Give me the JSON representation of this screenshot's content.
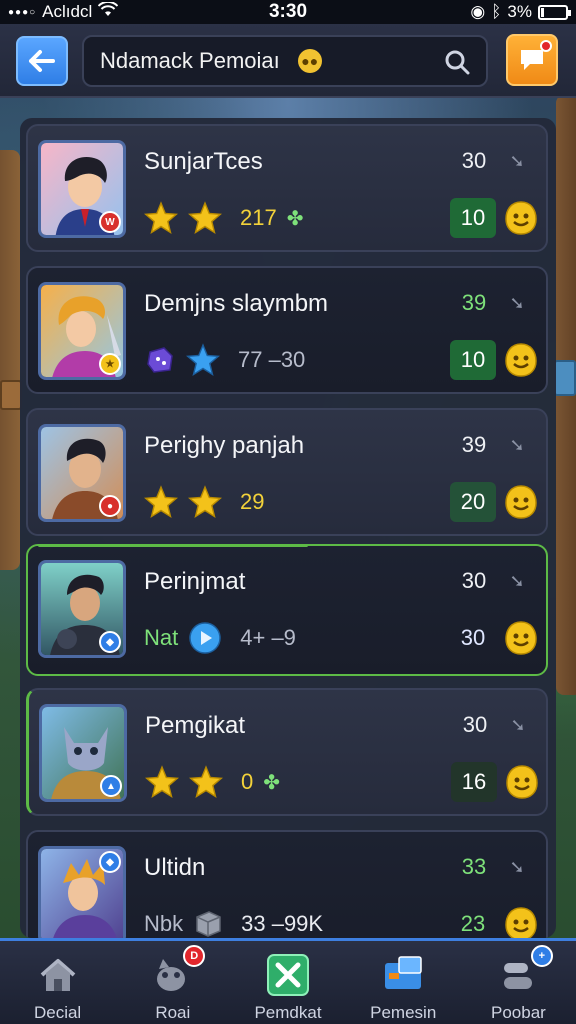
{
  "status_bar": {
    "carrier": "Aclıdcl",
    "time": "3:30",
    "battery_text": "3%"
  },
  "header": {
    "search_text": "Ndamack Pemoiaı"
  },
  "players": [
    {
      "name": "SunjarTces",
      "top_value": "30",
      "top_value_color": "#eef0f4",
      "stat_text": "217",
      "score": "10",
      "stars": 2,
      "avatar_badge_text": "W"
    },
    {
      "name": "Demjns slaymbm",
      "top_value": "39",
      "top_value_color": "#7ee17a",
      "stat_text": "77 –30",
      "score": "10"
    },
    {
      "name": "Perighy panjah",
      "top_value": "39",
      "top_value_color": "#eef0f4",
      "stat_text": "29",
      "score": "20",
      "stars": 2
    },
    {
      "name": "Perinjmat",
      "top_value": "30",
      "top_value_color": "#eef0f4",
      "stat_prefix": "Nat",
      "stat_text": "4+ –9",
      "score": "30"
    },
    {
      "name": "Pemgikat",
      "top_value": "30",
      "top_value_color": "#eef0f4",
      "stat_text": "0",
      "score": "16",
      "stars": 2
    },
    {
      "name": "Ultidn",
      "top_value": "33",
      "top_value_color": "#7ee17a",
      "stat_prefix": "Nbk",
      "stat_text": "33 –99K",
      "score": "23"
    }
  ],
  "bottom_nav": [
    {
      "label": "Decial",
      "icon": "home-icon"
    },
    {
      "label": "Roai",
      "icon": "creature-icon",
      "badge": "D"
    },
    {
      "label": "Pemdkat",
      "icon": "battle-icon"
    },
    {
      "label": "Pemesin",
      "icon": "shop-icon"
    },
    {
      "label": "Poobar",
      "icon": "profile-icon",
      "badge": "+"
    }
  ],
  "colors": {
    "accent_blue": "#2f7ee6",
    "accent_orange": "#f08a16",
    "score_green": "#1f6a36",
    "highlight_green": "#5dbb46",
    "star_yellow": "#f3c21a"
  }
}
